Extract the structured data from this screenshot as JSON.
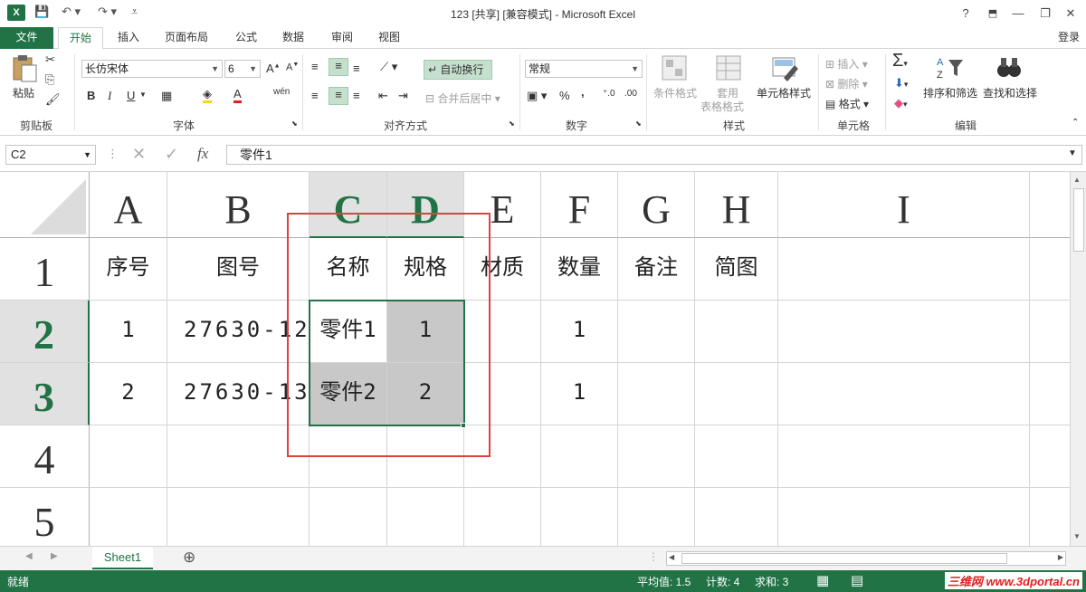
{
  "window": {
    "title": "123  [共享]  [兼容模式] - Microsoft Excel",
    "login": "登录",
    "help": "?",
    "minimize": "—",
    "restore": "❐",
    "close": "✕"
  },
  "tabs": [
    "文件",
    "开始",
    "插入",
    "页面布局",
    "公式",
    "数据",
    "审阅",
    "视图"
  ],
  "ribbon": {
    "clipboard": {
      "paste": "粘贴",
      "group": "剪贴板"
    },
    "font": {
      "name": "长仿宋体",
      "size": "6",
      "bold": "B",
      "italic": "I",
      "underline": "U",
      "group": "字体",
      "grow": "A",
      "shrink": "A",
      "phonetic": "wén"
    },
    "alignment": {
      "wrap": "自动换行",
      "merge": "合并后居中",
      "group": "对齐方式"
    },
    "number": {
      "format": "常规",
      "percent": "%",
      "comma": ",",
      "group": "数字"
    },
    "styles": {
      "conditional": "条件格式",
      "table1": "套用",
      "table2": "表格格式",
      "cell": "单元格样式",
      "group": "样式"
    },
    "cells": {
      "insert": "插入",
      "delete": "删除",
      "format": "格式",
      "group": "单元格"
    },
    "editing": {
      "sort": "排序和筛选",
      "find": "查找和选择",
      "group": "编辑"
    }
  },
  "formula_bar": {
    "name_box": "C2",
    "fx": "fx",
    "value": "零件1"
  },
  "columns": [
    "A",
    "B",
    "C",
    "D",
    "E",
    "F",
    "G",
    "H",
    "I"
  ],
  "rows": [
    "1",
    "2",
    "3",
    "4",
    "5"
  ],
  "cells": {
    "r1": [
      "序号",
      "图号",
      "名称",
      "规格",
      "材质",
      "数量",
      "备注",
      "简图",
      ""
    ],
    "r2": [
      "1",
      "27630-12",
      "零件1",
      "1",
      "",
      "1",
      "",
      "",
      ""
    ],
    "r3": [
      "2",
      "27630-13",
      "零件2",
      "2",
      "",
      "1",
      "",
      "",
      ""
    ],
    "r4": [
      "",
      "",
      "",
      "",
      "",
      "",
      "",
      "",
      ""
    ],
    "r5": [
      "",
      "",
      "",
      "",
      "",
      "",
      "",
      "",
      ""
    ]
  },
  "sheet": {
    "tab": "Sheet1",
    "add": "⊕"
  },
  "status": {
    "ready": "就绪",
    "average": "平均值: 1.5",
    "count": "计数: 4",
    "sum": "求和: 3",
    "watermark": "三维网 www.3dportal.cn"
  },
  "colors": {
    "accent": "#217346",
    "highlight": "#e04040"
  }
}
